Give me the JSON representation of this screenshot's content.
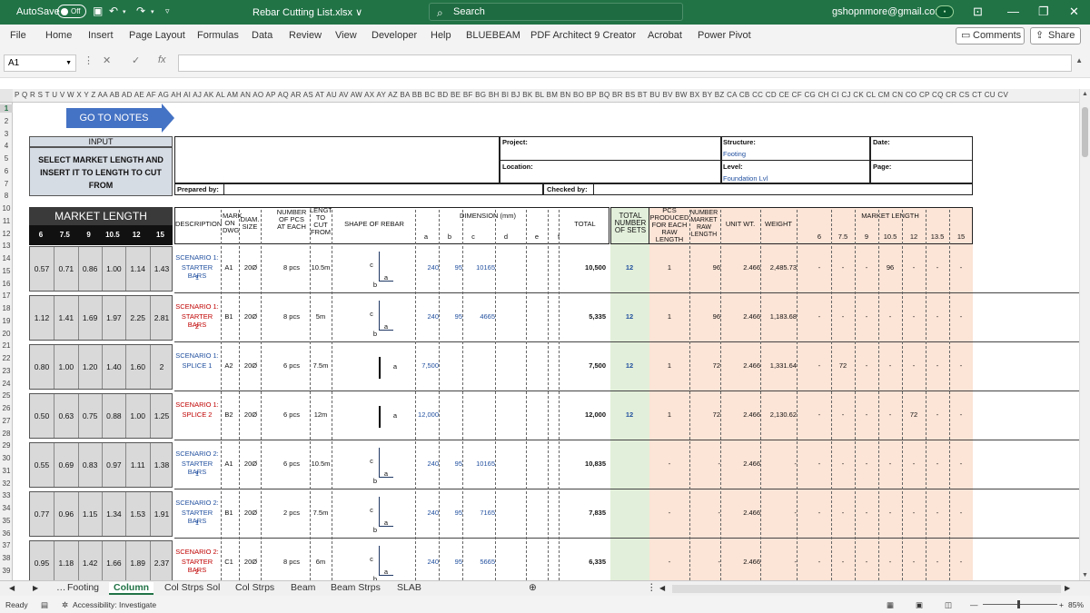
{
  "titlebar": {
    "autosave": "AutoSave",
    "toggle": "Off",
    "filename": "Rebar Cutting List.xlsx",
    "search": "Search",
    "email": "gshopnmore@gmail.com"
  },
  "ribbon": {
    "tabs": [
      "File",
      "Home",
      "Insert",
      "Page Layout",
      "Formulas",
      "Data",
      "Review",
      "View",
      "Developer",
      "Help",
      "BLUEBEAM",
      "PDF Architect 9 Creator",
      "Acrobat",
      "Power Pivot"
    ],
    "comments": "Comments",
    "share": "Share"
  },
  "formula": {
    "namebox": "A1",
    "fx": "fx"
  },
  "columns": "P Q R S T U V W X Y Z AA AB AD AE AF AG AH AI AJ AK AL AM AN AO AP AQ AR AS AT AU AV AW AX AY AZ BA BB BC BD BE BF BG BH BI BJ BK BL BM BN BO BP BQ BR BS BT BU BV BW BX BY BZ CA CB CC CD CE CF CG CH CI CJ CK CL CM CN CO CP CQ CR CS CT CU CV",
  "rows": [
    "1",
    "2",
    "3",
    "4",
    "5",
    "6",
    "7",
    "8",
    "10",
    "11",
    "12",
    "13",
    "14",
    "15",
    "16",
    "17",
    "18",
    "19",
    "20",
    "21",
    "22",
    "23",
    "24",
    "25",
    "26",
    "27",
    "28",
    "29",
    "30",
    "31",
    "32",
    "33",
    "34",
    "35",
    "36",
    "37",
    "38",
    "39"
  ],
  "left": {
    "goto": "GO TO NOTES",
    "input_header": "INPUT",
    "input_text": "SELECT MARKET LENGTH AND INSERT IT TO LENGTH TO CUT FROM",
    "market_length": "MARKET LENGTH",
    "lengths": [
      "6",
      "7.5",
      "9",
      "10.5",
      "12",
      "15"
    ],
    "rows": [
      [
        "0.57",
        "0.71",
        "0.86",
        "1.00",
        "1.14",
        "1.43"
      ],
      [
        "1.12",
        "1.41",
        "1.69",
        "1.97",
        "2.25",
        "2.81"
      ],
      [
        "0.80",
        "1.00",
        "1.20",
        "1.40",
        "1.60",
        "2"
      ],
      [
        "0.50",
        "0.63",
        "0.75",
        "0.88",
        "1.00",
        "1.25"
      ],
      [
        "0.55",
        "0.69",
        "0.83",
        "0.97",
        "1.11",
        "1.38"
      ],
      [
        "0.77",
        "0.96",
        "1.15",
        "1.34",
        "1.53",
        "1.91"
      ],
      [
        "0.95",
        "1.18",
        "1.42",
        "1.66",
        "1.89",
        "2.37"
      ]
    ]
  },
  "header": {
    "project": "Project:",
    "location": "Location:",
    "prepared_by": "Prepared by:",
    "checked_by": "Checked by:",
    "structure": "Structure:",
    "structure_val": "Footing",
    "level": "Level:",
    "level_val": "Foundation Lvl",
    "date": "Date:",
    "page": "Page:"
  },
  "cols": {
    "description": "DESCRIPTION",
    "mark": "MARK ON DWG",
    "diam": "DIAM. SIZE",
    "npcs": "NUMBER OF PCS AT EACH",
    "length": "LENGTH TO CUT FROM",
    "shape": "SHAPE OF REBAR",
    "dimension": "DIMENSION (mm)",
    "dims": [
      "a",
      "b",
      "c",
      "d",
      "e",
      "f"
    ],
    "total": "TOTAL",
    "total_sets": "TOTAL NUMBER OF SETS",
    "pcs_produced": "PCS PRODUCED FOR EACH RAW LENGTH",
    "num_raw": "NUMBER MARKET RAW LENGTH",
    "unit_wt": "UNIT WT.",
    "weight": "WEIGHT",
    "market_length": "MARKET LENGTH",
    "ml_vals": [
      "6",
      "7.5",
      "9",
      "10.5",
      "12",
      "13.5",
      "15"
    ]
  },
  "data": [
    {
      "s1": "SCENARIO 1:",
      "s2": "STARTER BARS",
      "s3": "1",
      "red": false,
      "mark": "A1",
      "diam": "20Ø",
      "pcs": "8 pcs",
      "len": "10.5m",
      "a": "240",
      "b": "95",
      "c": "10165",
      "total": "10,500",
      "sets": "12",
      "produced": "1",
      "raw": "96",
      "uwt": "2.466",
      "wt": "2,485.73",
      "ml": [
        "-",
        "-",
        "-",
        "96",
        "-",
        "-",
        "-"
      ],
      "shape": "L"
    },
    {
      "s1": "SCENARIO 1:",
      "s2": "STARTER BARS",
      "s3": "2",
      "red": true,
      "mark": "B1",
      "diam": "20Ø",
      "pcs": "8 pcs",
      "len": "5m",
      "a": "240",
      "b": "95",
      "c": "4665",
      "total": "5,335",
      "sets": "12",
      "produced": "1",
      "raw": "96",
      "uwt": "2.466",
      "wt": "1,183.68",
      "ml": [
        "-",
        "-",
        "-",
        "-",
        "-",
        "-",
        "-"
      ],
      "shape": "L"
    },
    {
      "s1": "SCENARIO 1:",
      "s2": "SPLICE 1",
      "s3": "",
      "red": false,
      "mark": "A2",
      "diam": "20Ø",
      "pcs": "6 pcs",
      "len": "7.5m",
      "a": "7,500",
      "b": "",
      "c": "",
      "total": "7,500",
      "sets": "12",
      "produced": "1",
      "raw": "72",
      "uwt": "2.466",
      "wt": "1,331.64",
      "ml": [
        "-",
        "72",
        "-",
        "-",
        "-",
        "-",
        "-"
      ],
      "shape": "I"
    },
    {
      "s1": "SCENARIO 1:",
      "s2": "SPLICE 2",
      "s3": "",
      "red": true,
      "mark": "B2",
      "diam": "20Ø",
      "pcs": "6 pcs",
      "len": "12m",
      "a": "12,000",
      "b": "",
      "c": "",
      "total": "12,000",
      "sets": "12",
      "produced": "1",
      "raw": "72",
      "uwt": "2.466",
      "wt": "2,130.62",
      "ml": [
        "-",
        "-",
        "-",
        "-",
        "72",
        "-",
        "-"
      ],
      "shape": "I"
    },
    {
      "s1": "SCENARIO 2:",
      "s2": "STARTER BARS",
      "s3": "1",
      "red": false,
      "mark": "A1",
      "diam": "20Ø",
      "pcs": "6 pcs",
      "len": "10.5m",
      "a": "240",
      "b": "95",
      "c": "10165",
      "total": "10,835",
      "sets": "",
      "produced": "-",
      "raw": "-",
      "uwt": "2.466",
      "wt": "-",
      "ml": [
        "-",
        "-",
        "-",
        "-",
        "-",
        "-",
        "-"
      ],
      "shape": "L"
    },
    {
      "s1": "SCENARIO 2:",
      "s2": "STARTER BARS",
      "s3": "1",
      "red": false,
      "mark": "B1",
      "diam": "20Ø",
      "pcs": "2 pcs",
      "len": "7.5m",
      "a": "240",
      "b": "95",
      "c": "7165",
      "total": "7,835",
      "sets": "",
      "produced": "-",
      "raw": "-",
      "uwt": "2.466",
      "wt": "-",
      "ml": [
        "-",
        "-",
        "-",
        "-",
        "-",
        "-",
        "-"
      ],
      "shape": "L"
    },
    {
      "s1": "SCENARIO 2:",
      "s2": "STARTER BARS",
      "s3": "2",
      "red": true,
      "mark": "C1",
      "diam": "20Ø",
      "pcs": "8 pcs",
      "len": "6m",
      "a": "240",
      "b": "95",
      "c": "5665",
      "total": "6,335",
      "sets": "",
      "produced": "-",
      "raw": "-",
      "uwt": "2.466",
      "wt": "-",
      "ml": [
        "-",
        "-",
        "-",
        "-",
        "-",
        "-",
        "-"
      ],
      "shape": "L"
    }
  ],
  "sheets": [
    "Footing",
    "Column",
    "Col Strps Sol",
    "Col Strps",
    "Beam",
    "Beam Strps",
    "SLAB"
  ],
  "status": {
    "ready": "Ready",
    "accessibility": "Accessibility: Investigate",
    "zoom": "85%"
  }
}
